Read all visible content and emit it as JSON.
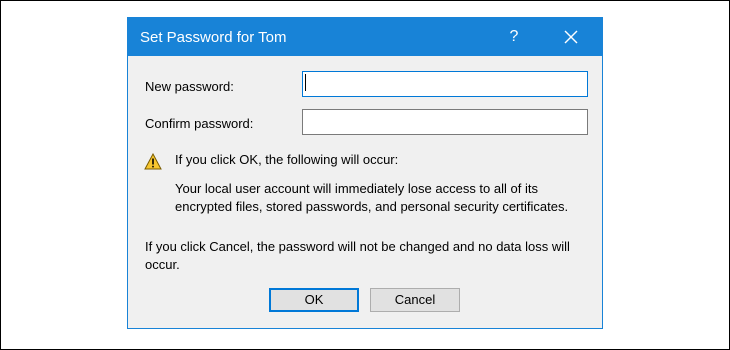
{
  "dialog": {
    "title": "Set Password for Tom",
    "help_glyph": "?",
    "new_password_label": "New password:",
    "new_password_value": "",
    "confirm_password_label": "Confirm password:",
    "confirm_password_value": "",
    "warning_heading": "If you click OK, the following will occur:",
    "warning_line1": "Your local user account will immediately lose access to all of its",
    "warning_line2": "encrypted files, stored passwords, and personal security certificates.",
    "cancel_note_line1": "If you click Cancel, the password will not be changed and no data loss will",
    "cancel_note_line2": "occur.",
    "ok_label": "OK",
    "cancel_label": "Cancel"
  },
  "icons": [
    "help-icon",
    "close-icon",
    "warning-icon"
  ],
  "colors": {
    "titlebar": "#1883d7",
    "dialog_bg": "#f0f0f0",
    "focus_border": "#0078d7",
    "warning_fill": "#f7c62f"
  }
}
